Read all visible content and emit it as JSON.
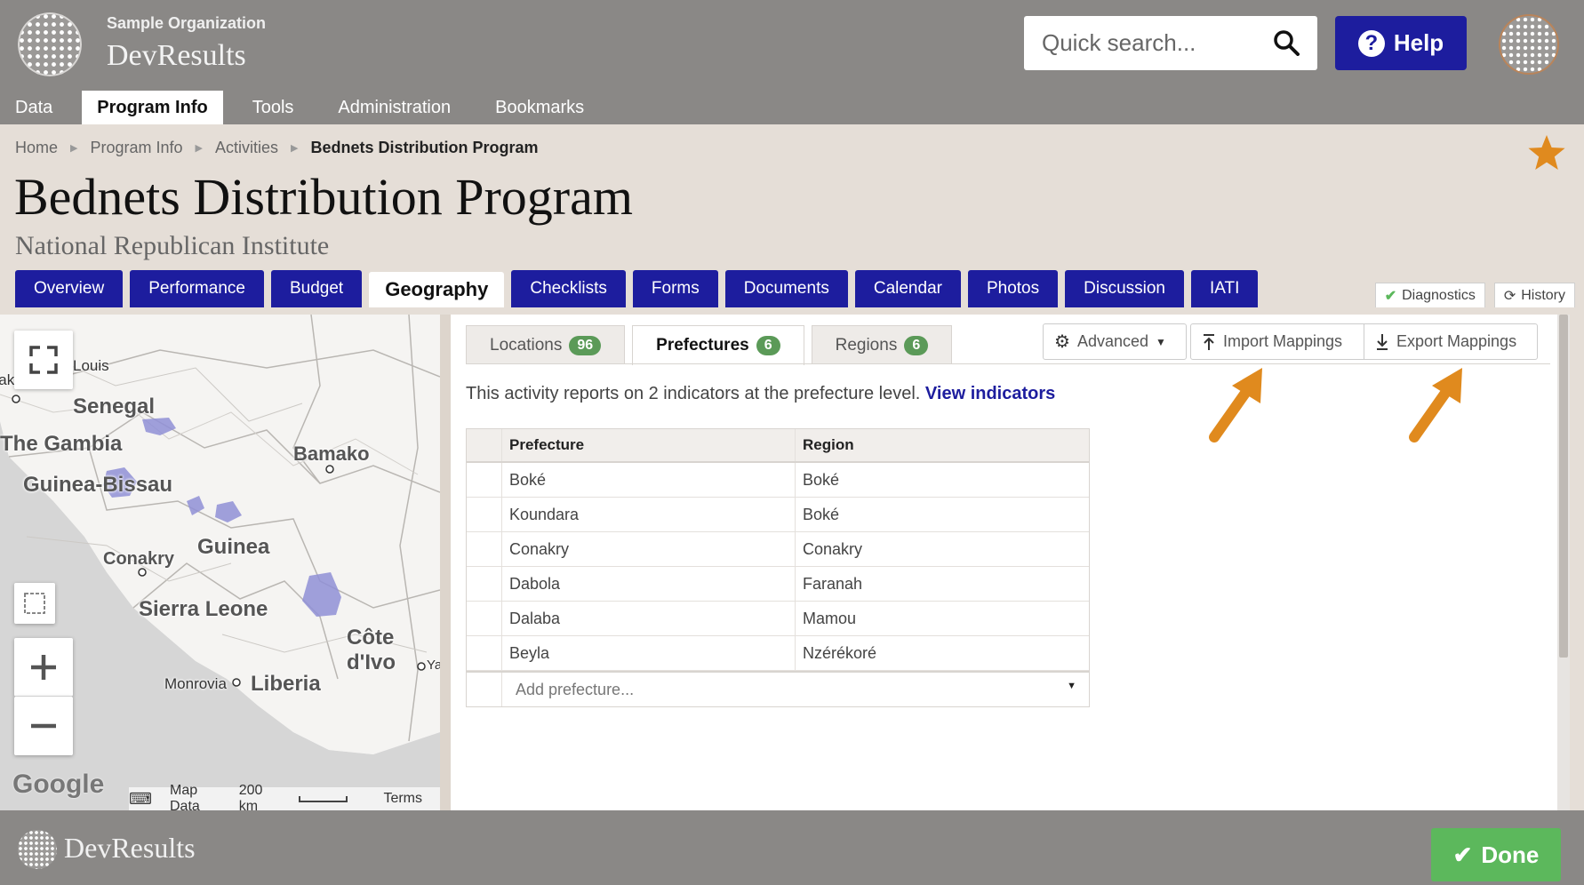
{
  "header": {
    "org_name": "Sample Organization",
    "app_name": "DevResults",
    "search_placeholder": "Quick search...",
    "help_label": "Help",
    "nav": [
      {
        "label": "Data",
        "active": false
      },
      {
        "label": "Program Info",
        "active": true
      },
      {
        "label": "Tools",
        "active": false
      },
      {
        "label": "Administration",
        "active": false
      },
      {
        "label": "Bookmarks",
        "active": false
      }
    ]
  },
  "breadcrumb": [
    "Home",
    "Program Info",
    "Activities",
    "Bednets Distribution Program"
  ],
  "page": {
    "title": "Bednets Distribution Program",
    "subtitle": "National Republican Institute",
    "favorite_color": "#e08a1e"
  },
  "tabs": [
    {
      "label": "Overview",
      "active": false
    },
    {
      "label": "Performance",
      "active": false
    },
    {
      "label": "Budget",
      "active": false
    },
    {
      "label": "Geography",
      "active": true
    },
    {
      "label": "Checklists",
      "active": false
    },
    {
      "label": "Forms",
      "active": false
    },
    {
      "label": "Documents",
      "active": false
    },
    {
      "label": "Calendar",
      "active": false
    },
    {
      "label": "Photos",
      "active": false
    },
    {
      "label": "Discussion",
      "active": false
    },
    {
      "label": "IATI",
      "active": false
    }
  ],
  "side_tabs": {
    "diagnostics": "Diagnostics",
    "history": "History"
  },
  "map": {
    "labels": {
      "louis": "Louis",
      "dakar": "Dakar",
      "senegal": "Senegal",
      "gambia": "The Gambia",
      "bamako": "Bamako",
      "guinea_bissau": "Guinea-Bissau",
      "guinea": "Guinea",
      "conakry": "Conakry",
      "sierra_leone": "Sierra Leone",
      "cote": "Côte d'Ivo",
      "ya": "Ya",
      "monrovia": "Monrovia",
      "liberia": "Liberia"
    },
    "google": "Google",
    "footer": {
      "map_data": "Map Data",
      "scale": "200 km",
      "terms": "Terms"
    },
    "highlight_color": "#8f8fd6"
  },
  "subtabs": [
    {
      "label": "Locations",
      "count": "96",
      "active": false
    },
    {
      "label": "Prefectures",
      "count": "6",
      "active": true
    },
    {
      "label": "Regions",
      "count": "6",
      "active": false
    }
  ],
  "toolbar": {
    "advanced": "Advanced",
    "import": "Import Mappings",
    "export": "Export Mappings"
  },
  "note": {
    "text": "This activity reports on 2 indicators at the prefecture level.",
    "link": "View indicators"
  },
  "grid": {
    "headers": [
      "Prefecture",
      "Region"
    ],
    "rows": [
      [
        "Boké",
        "Boké"
      ],
      [
        "Koundara",
        "Boké"
      ],
      [
        "Conakry",
        "Conakry"
      ],
      [
        "Dabola",
        "Faranah"
      ],
      [
        "Dalaba",
        "Mamou"
      ],
      [
        "Beyla",
        "Nzérékoré"
      ]
    ],
    "add_placeholder": "Add prefecture..."
  },
  "footer": {
    "brand": "DevResults",
    "done_label": "Done"
  },
  "colors": {
    "header_bg": "#8a8886",
    "primary": "#1d1d9e",
    "success": "#5cb85c",
    "badge": "#5b9a58",
    "arrow": "#e08a1e"
  }
}
